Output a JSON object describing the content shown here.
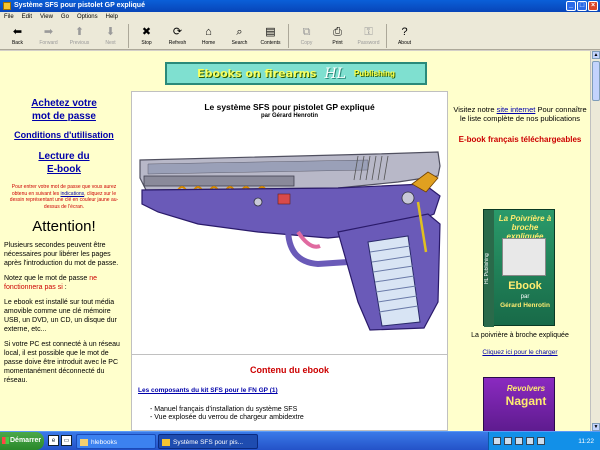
{
  "window": {
    "title": "Système SFS pour pistolet GP expliqué"
  },
  "menu": [
    "File",
    "Edit",
    "View",
    "Go",
    "Options",
    "Help"
  ],
  "toolbar": [
    {
      "label": "Back",
      "icon": "back-arrow-icon",
      "glyph": "⬅",
      "enabled": true
    },
    {
      "label": "Forward",
      "icon": "forward-arrow-icon",
      "glyph": "➡",
      "enabled": false
    },
    {
      "label": "Previous",
      "icon": "previous-icon",
      "glyph": "⬆",
      "enabled": false
    },
    {
      "label": "Next",
      "icon": "next-icon",
      "glyph": "⬇",
      "enabled": false
    },
    {
      "label": "Stop",
      "icon": "stop-icon",
      "glyph": "✖",
      "enabled": true
    },
    {
      "label": "Refresh",
      "icon": "refresh-icon",
      "glyph": "⟳",
      "enabled": true
    },
    {
      "label": "Home",
      "icon": "home-icon",
      "glyph": "⌂",
      "enabled": true
    },
    {
      "label": "Search",
      "icon": "search-icon",
      "glyph": "⌕",
      "enabled": true
    },
    {
      "label": "Contents",
      "icon": "contents-icon",
      "glyph": "▤",
      "enabled": true
    },
    {
      "label": "Copy",
      "icon": "copy-icon",
      "glyph": "⧉",
      "enabled": false
    },
    {
      "label": "Print",
      "icon": "print-icon",
      "glyph": "⎙",
      "enabled": true
    },
    {
      "label": "Password",
      "icon": "password-icon",
      "glyph": "⚿",
      "enabled": false
    },
    {
      "label": "About",
      "icon": "about-icon",
      "glyph": "?",
      "enabled": true
    }
  ],
  "banner": {
    "part1": "Ebooks on firearms",
    "part2": "HL",
    "part3": "Publishing"
  },
  "left": {
    "buy_link": "Achetez votre mot de passe",
    "conditions_link": "Conditions d'utilisation",
    "read_link": "Lecture du E-book",
    "note_before": "Pour entrer votre mot de passe que vous aurez obtenu en suivant les ",
    "note_link": "indications",
    "note_after": ", cliquez sur le dessin représentant une clé en couleur jaune au-dessus de l'écran.",
    "attention": "Attention!",
    "para1": "Plusieurs secondes peuvent être nécessaires pour libérer les pages après l'introduction du mot de passe.",
    "para2_before": "Notez que le mot de passe ",
    "para2_red": "ne fonctionnera pas si",
    "para2_after": " :",
    "para3": "Le ebook est installé sur tout média amovible comme une clé mémoire USB, un DVD, un CD, un disque dur externe, etc...",
    "para4": "Si votre PC est connecté à un réseau local, il est possible que le mot de passe doive être introduit avec le PC momentanément déconnecté du réseau."
  },
  "center": {
    "title": "Le système SFS pour pistolet GP expliqué",
    "author": "par Gérard Henrotin",
    "contenu": "Contenu du ebook",
    "components_link": "Les composants du kit SFS pour le FN GP (1)",
    "item1": "- Manuel français d'installation du système SFS",
    "item2": "- Vue explosée du verrou de chargeur ambidextre"
  },
  "right": {
    "visit_before": "Visitez notre ",
    "visit_link": "site internet",
    "visit_after": " Pour connaître le liste complète de nos publications",
    "ebook_fr": "E-book français téléchargeables",
    "cover1": {
      "spine": "HL Publishing",
      "title": "La Poivrière à broche expliquée",
      "ebook": "Ebook",
      "par": "par",
      "author": "Gérard Henrotin"
    },
    "caption": "La poivrière à broche expliquée",
    "order_link": "Cliquez ici pour le charger",
    "cover2": {
      "title1": "Revolvers",
      "title2": "Nagant"
    }
  },
  "taskbar": {
    "start": "Démarrer",
    "task1": "hlebooks",
    "task2": "Système SFS pour pis...",
    "clock": "11:22"
  }
}
